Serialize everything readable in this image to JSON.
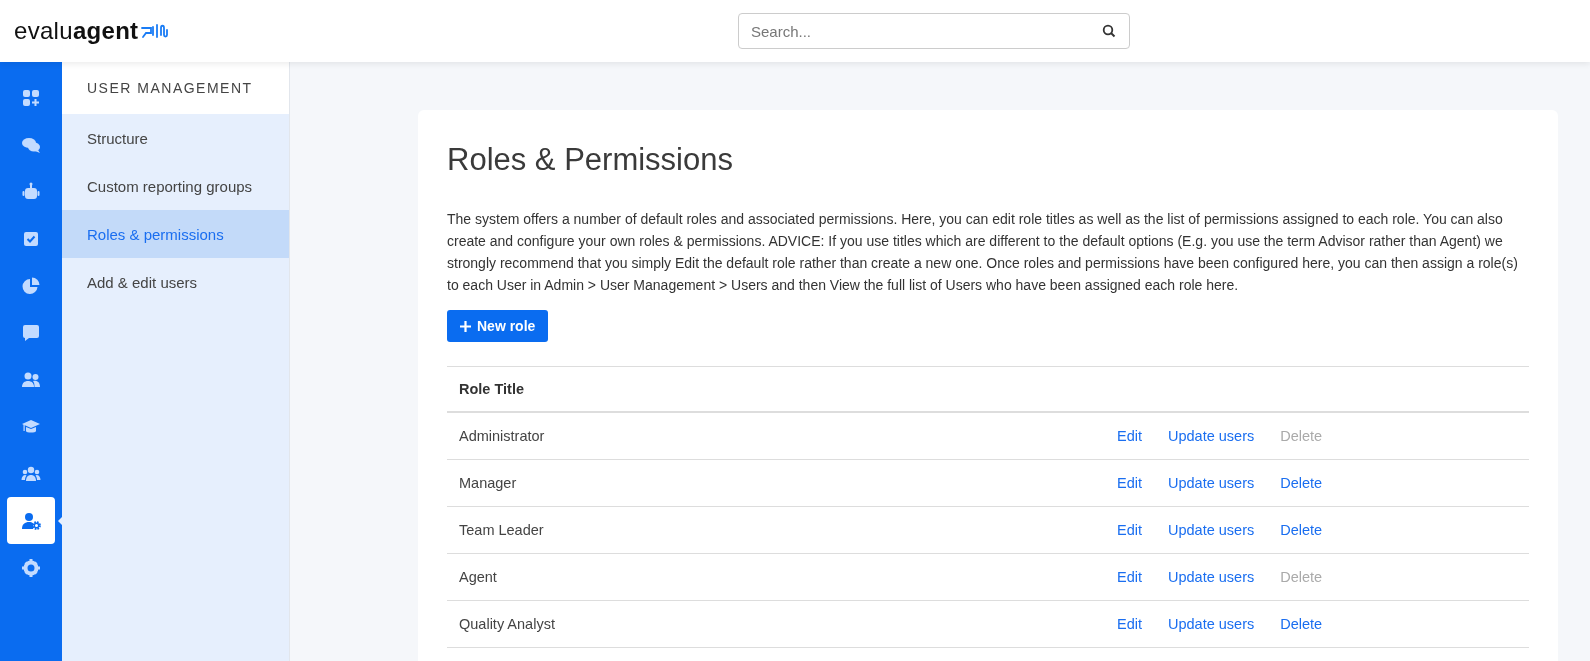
{
  "header": {
    "logo": "evalu**agent**",
    "search": {
      "placeholder": "Search..."
    }
  },
  "rail": [
    {
      "selected": false
    },
    {
      "selected": false
    },
    {
      "selected": false
    },
    {
      "selected": false
    },
    {
      "selected": false
    },
    {
      "selected": false
    },
    {
      "selected": false
    },
    {
      "selected": false
    },
    {
      "selected": false
    },
    {
      "selected": true
    },
    {
      "selected": false
    }
  ],
  "submenu": {
    "title": "USER MANAGEMENT",
    "items": [
      {
        "label": "Structure",
        "selected": false
      },
      {
        "label": "Custom reporting groups",
        "selected": false
      },
      {
        "label": "Roles & permissions",
        "selected": true
      },
      {
        "label": "Add & edit users",
        "selected": false
      }
    ]
  },
  "page": {
    "title": "Roles & Permissions",
    "description": "The system offers a number of default roles and associated permissions. Here, you can edit role titles as well as the list of permissions assigned to each role. You can also create and configure your own roles & permissions. ADVICE: If you use titles which are different to the default options (E.g. you use the term Advisor rather than Agent) we strongly recommend that you simply Edit the default role rather than create a new one. Once roles and permissions have been configured here, you can then assign a role(s) to each User in Admin > User Management > Users and then View the full list of Users who have been assigned each role here.",
    "new_button": "New role",
    "table": {
      "columns": [
        "Role Title"
      ],
      "rows": [
        {
          "title": "Administrator",
          "edit": "Edit",
          "update": "Update users",
          "delete": "Delete",
          "delete_disabled": true
        },
        {
          "title": "Manager",
          "edit": "Edit",
          "update": "Update users",
          "delete": "Delete",
          "delete_disabled": false
        },
        {
          "title": "Team Leader",
          "edit": "Edit",
          "update": "Update users",
          "delete": "Delete",
          "delete_disabled": false
        },
        {
          "title": "Agent",
          "edit": "Edit",
          "update": "Update users",
          "delete": "Delete",
          "delete_disabled": true
        },
        {
          "title": "Quality Analyst",
          "edit": "Edit",
          "update": "Update users",
          "delete": "Delete",
          "delete_disabled": false
        }
      ]
    }
  }
}
